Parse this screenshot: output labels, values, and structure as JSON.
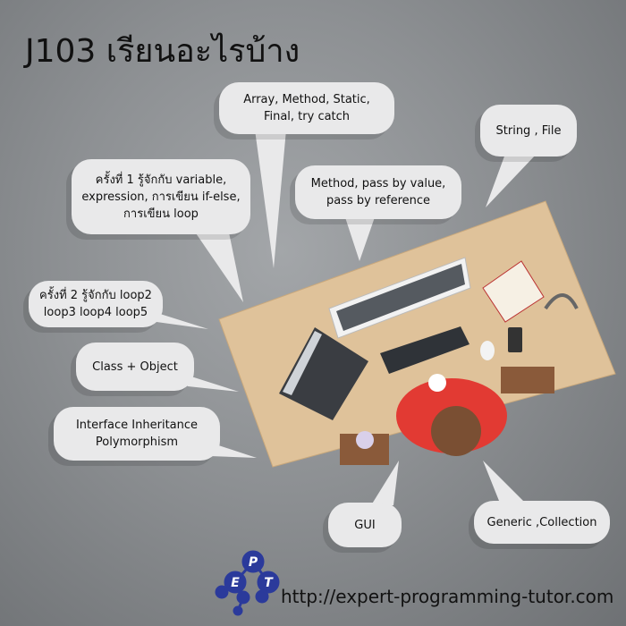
{
  "title": "J103 เรียนอะไรบ้าง",
  "bubbles": {
    "lesson1": [
      "ครั้งที่ 1 รู้จักกับ variable,",
      "expression, การเขียน if-else,",
      "การเขียน loop"
    ],
    "lesson2": [
      "ครั้งที่ 2 รู้จักกับ loop2",
      "loop3 loop4 loop5"
    ],
    "class_object": "Class + Object",
    "interface": [
      "Interface Inheritance",
      "Polymorphism"
    ],
    "array_method": [
      "Array, Method, Static,",
      "Final, try catch"
    ],
    "method_pass": [
      "Method, pass by value,",
      "pass by reference"
    ],
    "string_file": "String , File",
    "gui": "GUI",
    "generic": "Generic ,Collection"
  },
  "logo": {
    "letters": [
      "E",
      "P",
      "T"
    ],
    "color": "#2b3a9b"
  },
  "url": "http://expert-programming-tutor.com"
}
